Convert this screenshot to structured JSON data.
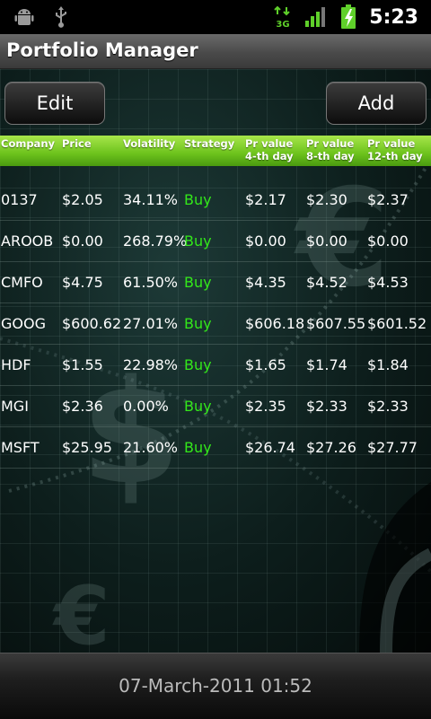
{
  "status_bar": {
    "time": "5:23",
    "network": "3G",
    "icons": [
      "android-debug-icon",
      "usb-icon",
      "network-3g-icon",
      "signal-icon",
      "battery-charging-icon"
    ]
  },
  "app": {
    "title": "Portfolio Manager"
  },
  "toolbar": {
    "edit_label": "Edit",
    "add_label": "Add"
  },
  "table": {
    "headers": {
      "company": "Company",
      "price": "Price",
      "volatility": "Volatility",
      "strategy": "Strategy",
      "pr4_l1": "Pr value",
      "pr4_l2": "4-th day",
      "pr8_l1": "Pr value",
      "pr8_l2": "8-th day",
      "pr12_l1": "Pr value",
      "pr12_l2": "12-th day"
    },
    "rows": [
      {
        "company": "0137",
        "price": "$2.05",
        "volatility": "34.11%",
        "strategy": "Buy",
        "pr4": "$2.17",
        "pr8": "$2.30",
        "pr12": "$2.37"
      },
      {
        "company": "AROOB",
        "price": "$0.00",
        "volatility": "268.79%",
        "strategy": "Buy",
        "pr4": "$0.00",
        "pr8": "$0.00",
        "pr12": "$0.00"
      },
      {
        "company": "CMFO",
        "price": "$4.75",
        "volatility": "61.50%",
        "strategy": "Buy",
        "pr4": "$4.35",
        "pr8": "$4.52",
        "pr12": "$4.53"
      },
      {
        "company": "GOOG",
        "price": "$600.62",
        "volatility": "27.01%",
        "strategy": "Buy",
        "pr4": "$606.18",
        "pr8": "$607.55",
        "pr12": "$601.52"
      },
      {
        "company": "HDF",
        "price": "$1.55",
        "volatility": "22.98%",
        "strategy": "Buy",
        "pr4": "$1.65",
        "pr8": "$1.74",
        "pr12": "$1.84"
      },
      {
        "company": "MGI",
        "price": "$2.36",
        "volatility": "0.00%",
        "strategy": "Buy",
        "pr4": "$2.35",
        "pr8": "$2.33",
        "pr12": "$2.33"
      },
      {
        "company": "MSFT",
        "price": "$25.95",
        "volatility": "21.60%",
        "strategy": "Buy",
        "pr4": "$26.74",
        "pr8": "$27.26",
        "pr12": "$27.77"
      }
    ]
  },
  "footer": {
    "timestamp": "07-March-2011 01:52"
  },
  "colors": {
    "header_green": "#6cc21c",
    "buy_green": "#33e81a",
    "background": "#0d1e1c"
  }
}
